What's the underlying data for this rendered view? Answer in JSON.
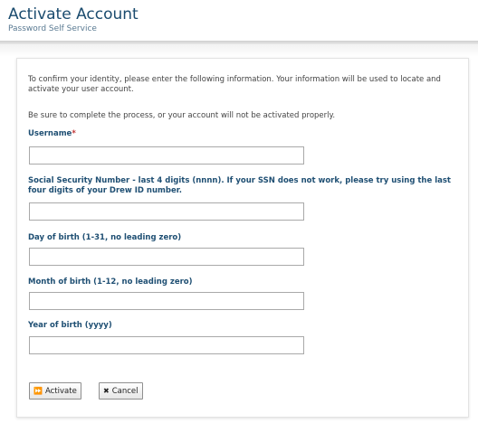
{
  "header": {
    "title": "Activate Account",
    "subtitle": "Password Self Service"
  },
  "form": {
    "intro": "To confirm your identity, please enter the following information. Your information will be used to locate and activate your user account.",
    "note": "Be sure to complete the process, or your account will not be activated properly.",
    "fields": [
      {
        "label": "Username",
        "required_mark": "*",
        "value": "",
        "placeholder": ""
      },
      {
        "label": "Social Security Number - last 4 digits (nnnn). If your SSN does not work, please try using the last four digits of your Drew ID number.",
        "value": "",
        "placeholder": ""
      },
      {
        "label": "Day of birth (1-31, no leading zero)",
        "value": "",
        "placeholder": ""
      },
      {
        "label": "Month of birth (1-12, no leading zero)",
        "value": "",
        "placeholder": ""
      },
      {
        "label": "Year of birth (yyyy)",
        "value": "",
        "placeholder": ""
      }
    ]
  },
  "buttons": {
    "activate": {
      "label": "Activate",
      "icon": "fast-forward-icon"
    },
    "cancel": {
      "label": "Cancel",
      "icon": "x-icon"
    }
  }
}
